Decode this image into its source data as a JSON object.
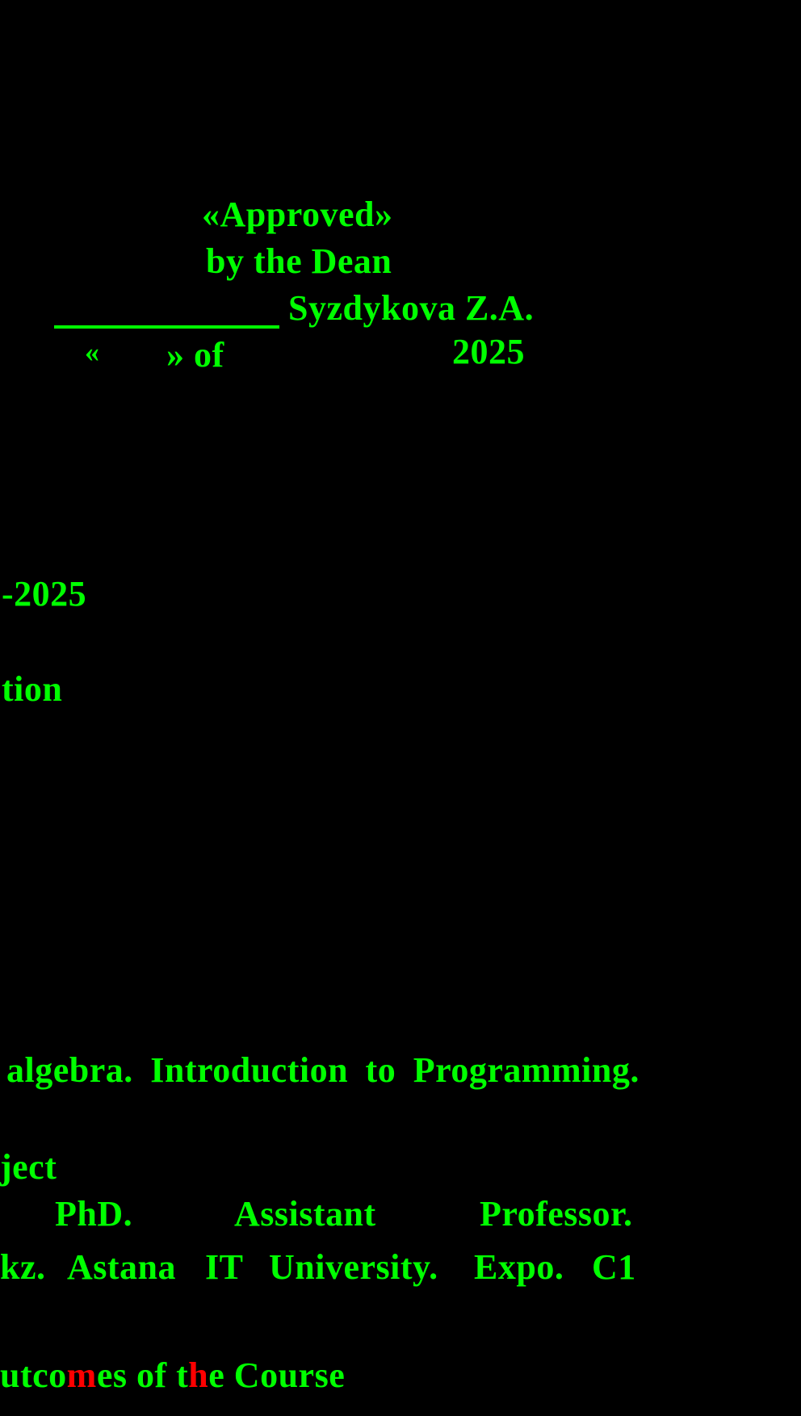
{
  "approval": {
    "title": "«Approved»",
    "by_line": "by the Dean",
    "name": "Syzdykova Z.A.",
    "date_open_quote": "«",
    "date_close_quote_of": "» of",
    "year": "2025"
  },
  "fragments": {
    "year_range_tail": "-2025",
    "section_tail": "tion"
  },
  "prerequisites": {
    "line": "algebra. Introduction to Programming."
  },
  "instructor": {
    "subject_tail": "ject",
    "degree": "PhD.",
    "rank_word1": "Assistant",
    "rank_word2": "Professor.",
    "email_tail": "kz.",
    "org_word1": "Astana",
    "org_word2": "IT",
    "org_word3": "University.",
    "org_word4": "Expo.",
    "org_word5": "C1"
  },
  "outcomes_heading": {
    "part1": "utco",
    "part2": "m",
    "part3": "es of t",
    "part4": "h",
    "part5": "e Course"
  },
  "colors": {
    "background": "#000000",
    "text": "#00ff00",
    "highlight": "#ff0000"
  }
}
